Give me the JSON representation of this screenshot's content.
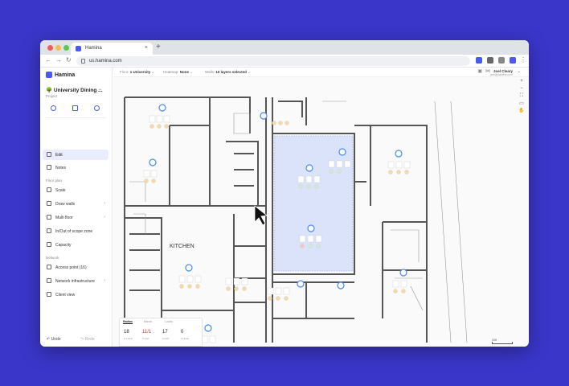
{
  "browser": {
    "tab_title": "Hamina",
    "url": "us.hamina.com",
    "new_tab": "+",
    "tab_close": "×"
  },
  "sidebar": {
    "logo": "Hamina",
    "project_name": "🌳 University Dining ...",
    "project_sub": "Project",
    "items": [
      {
        "label": "Edit",
        "icon": "edit-icon",
        "active": true
      },
      {
        "label": "Notes",
        "icon": "notes-icon"
      },
      {
        "label": "Scale",
        "icon": "scale-icon"
      },
      {
        "label": "Draw walls",
        "icon": "wall-icon"
      },
      {
        "label": "Multi floor",
        "icon": "floor-icon"
      },
      {
        "label": "In/Out of scope zone",
        "icon": "zone-icon"
      },
      {
        "label": "Capacity",
        "icon": "capacity-icon"
      },
      {
        "label": "Access point (16)",
        "icon": "ap-icon"
      },
      {
        "label": "Network infrastructure",
        "icon": "network-icon"
      },
      {
        "label": "Client view",
        "icon": "client-icon"
      }
    ],
    "section_floor_plan": "Floor plan",
    "section_network": "Network",
    "undo": "Undo",
    "redo": "Redo"
  },
  "topbar": {
    "floor_label": "Floor:",
    "floor_value": "1 University",
    "heatmap_label": "Heatmap:",
    "heatmap_value": "None",
    "walls_label": "Walls:",
    "walls_value": "10 layers selected",
    "user_name": "Joel Cleary",
    "user_email": "joel@hamina.com"
  },
  "canvas": {
    "room_label_kitchen": "KITCHEN",
    "highlight_color": "#dbe3fb",
    "ap_color": "#4a8be8"
  },
  "bottom_panel": {
    "tabs": [
      "Radios",
      "Bands",
      "Loads"
    ],
    "values": [
      {
        "num": "18",
        "cap": "2.4 GHz"
      },
      {
        "num": "11/1",
        "cap": "5 GHz"
      },
      {
        "num": "17",
        "cap": "6 GHz"
      },
      {
        "num": "0",
        "cap": "Cellular"
      }
    ]
  },
  "scale": "20ft"
}
